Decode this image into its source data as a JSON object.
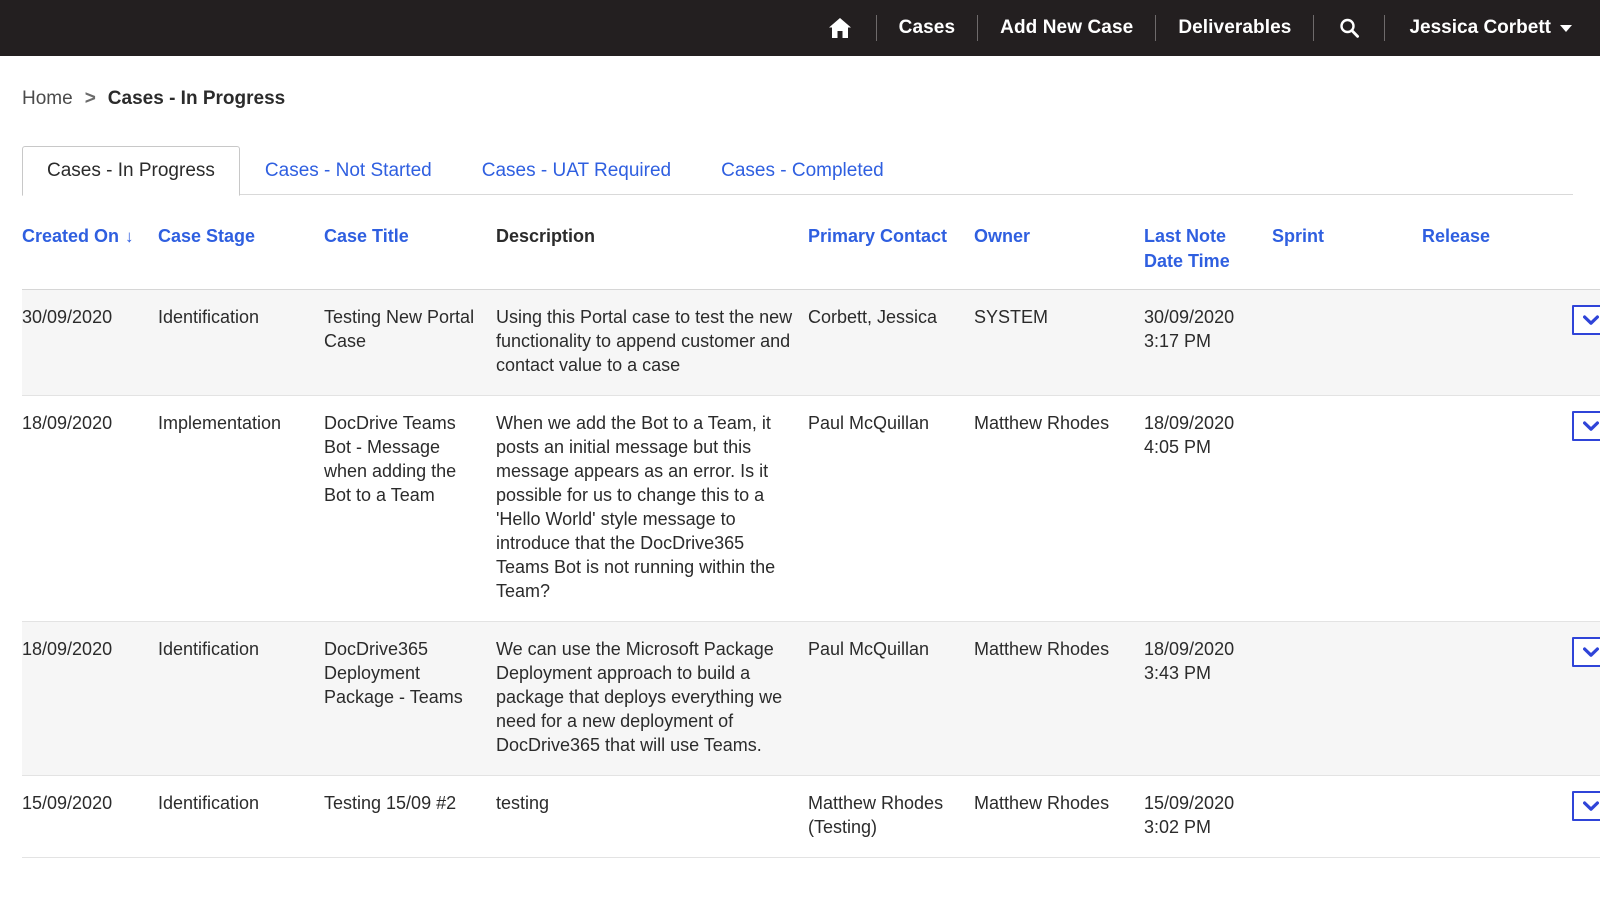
{
  "topnav": {
    "home_icon": "home-icon",
    "search_icon": "search-icon",
    "items": [
      {
        "label": "Cases"
      },
      {
        "label": "Add New Case"
      },
      {
        "label": "Deliverables"
      }
    ],
    "user": {
      "name": "Jessica Corbett",
      "caret_icon": "caret-down-icon"
    }
  },
  "breadcrumb": {
    "home": "Home",
    "separator": ">",
    "current": "Cases - In Progress"
  },
  "tabs": [
    {
      "label": "Cases - In Progress",
      "active": true
    },
    {
      "label": "Cases - Not Started",
      "active": false
    },
    {
      "label": "Cases - UAT Required",
      "active": false
    },
    {
      "label": "Cases - Completed",
      "active": false
    }
  ],
  "table": {
    "columns": [
      {
        "label": "Created On",
        "link": true,
        "sorted": true,
        "sort_arrow": "↓"
      },
      {
        "label": "Case Stage",
        "link": true
      },
      {
        "label": "Case Title",
        "link": true
      },
      {
        "label": "Description",
        "link": false
      },
      {
        "label": "Primary Contact",
        "link": true
      },
      {
        "label": "Owner",
        "link": true
      },
      {
        "label": "Last Note Date Time",
        "link": true
      },
      {
        "label": "Sprint",
        "link": true
      },
      {
        "label": "Release",
        "link": true
      }
    ],
    "rows": [
      {
        "created_on": "30/09/2020",
        "case_stage": "Identification",
        "case_title": "Testing New Portal Case",
        "description": "Using this Portal case to test the new functionality to append customer and contact value to a case",
        "primary_contact": "Corbett, Jessica",
        "owner": "SYSTEM",
        "last_note_date_time": "30/09/2020 3:17 PM",
        "sprint": "",
        "release": "",
        "action_icon": "chevron-down-icon"
      },
      {
        "created_on": "18/09/2020",
        "case_stage": "Implementation",
        "case_title": "DocDrive Teams Bot - Message when adding the Bot to a Team",
        "description": "When we add the Bot to a Team, it posts an initial message but this message appears as an error. Is it possible for us to change this to a 'Hello World' style message to introduce that the DocDrive365 Teams Bot is not running within the Team?",
        "primary_contact": "Paul McQuillan",
        "owner": "Matthew Rhodes",
        "last_note_date_time": "18/09/2020 4:05 PM",
        "sprint": "",
        "release": "",
        "action_icon": "chevron-down-icon"
      },
      {
        "created_on": "18/09/2020",
        "case_stage": "Identification",
        "case_title": "DocDrive365 Deployment Package - Teams",
        "description": "We can use the Microsoft Package Deployment approach to build a package that deploys everything we need for a new deployment of DocDrive365 that will use Teams.",
        "primary_contact": "Paul McQuillan",
        "owner": "Matthew Rhodes",
        "last_note_date_time": "18/09/2020 3:43 PM",
        "sprint": "",
        "release": "",
        "action_icon": "chevron-down-icon"
      },
      {
        "created_on": "15/09/2020",
        "case_stage": "Identification",
        "case_title": "Testing 15/09 #2",
        "description": "testing",
        "primary_contact": "Matthew Rhodes (Testing)",
        "owner": "Matthew Rhodes",
        "last_note_date_time": "15/09/2020 3:02 PM",
        "sprint": "",
        "release": "",
        "action_icon": "chevron-down-icon"
      }
    ]
  },
  "colors": {
    "nav_bg": "#231f20",
    "link_blue": "#2f5fe0",
    "button_blue": "#2f44d8",
    "row_alt_bg": "#f6f6f6",
    "text": "#2b2b2b"
  }
}
